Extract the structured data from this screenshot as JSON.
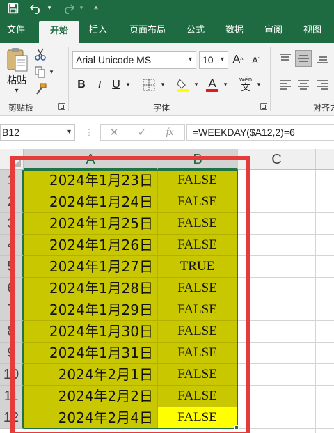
{
  "qat": {
    "save_icon": "save-icon",
    "undo_icon": "undo-icon",
    "redo_icon": "redo-icon"
  },
  "tabs": [
    {
      "label": "文件"
    },
    {
      "label": "开始"
    },
    {
      "label": "插入"
    },
    {
      "label": "页面布局"
    },
    {
      "label": "公式"
    },
    {
      "label": "数据"
    },
    {
      "label": "审阅"
    },
    {
      "label": "视图"
    }
  ],
  "ribbon": {
    "paste_label": "粘贴",
    "clipboard_group": "剪贴板",
    "font_group": "字体",
    "align_group": "对齐方",
    "font_name": "Arial Unicode MS",
    "font_size": "10",
    "bold": "B",
    "italic": "I",
    "underline": "U",
    "grow_font": "A",
    "shrink_font": "A",
    "font_color_glyph": "A",
    "phonetic_top": "wén",
    "phonetic_bottom": "文"
  },
  "formula_bar": {
    "name_box": "B12",
    "cancel": "✕",
    "enter": "✓",
    "fx": "fx",
    "formula": "=WEEKDAY($A12,2)=6"
  },
  "grid": {
    "columns": [
      "A",
      "B",
      "C"
    ],
    "rows": [
      {
        "num": "1",
        "a": "2024年1月23日",
        "b": "FALSE"
      },
      {
        "num": "2",
        "a": "2024年1月24日",
        "b": "FALSE"
      },
      {
        "num": "3",
        "a": "2024年1月25日",
        "b": "FALSE"
      },
      {
        "num": "4",
        "a": "2024年1月26日",
        "b": "FALSE"
      },
      {
        "num": "5",
        "a": "2024年1月27日",
        "b": "TRUE"
      },
      {
        "num": "6",
        "a": "2024年1月28日",
        "b": "FALSE"
      },
      {
        "num": "7",
        "a": "2024年1月29日",
        "b": "FALSE"
      },
      {
        "num": "8",
        "a": "2024年1月30日",
        "b": "FALSE"
      },
      {
        "num": "9",
        "a": "2024年1月31日",
        "b": "FALSE"
      },
      {
        "num": "10",
        "a": "2024年2月1日",
        "b": "FALSE"
      },
      {
        "num": "11",
        "a": "2024年2月2日",
        "b": "FALSE"
      },
      {
        "num": "12",
        "a": "2024年2月4日",
        "b": "FALSE"
      }
    ]
  },
  "colors": {
    "ribbon_green": "#1e6b41",
    "cell_olive": "#c9c700",
    "cell_yellow": "#ffff00",
    "annotation_red": "#e53b3b"
  }
}
